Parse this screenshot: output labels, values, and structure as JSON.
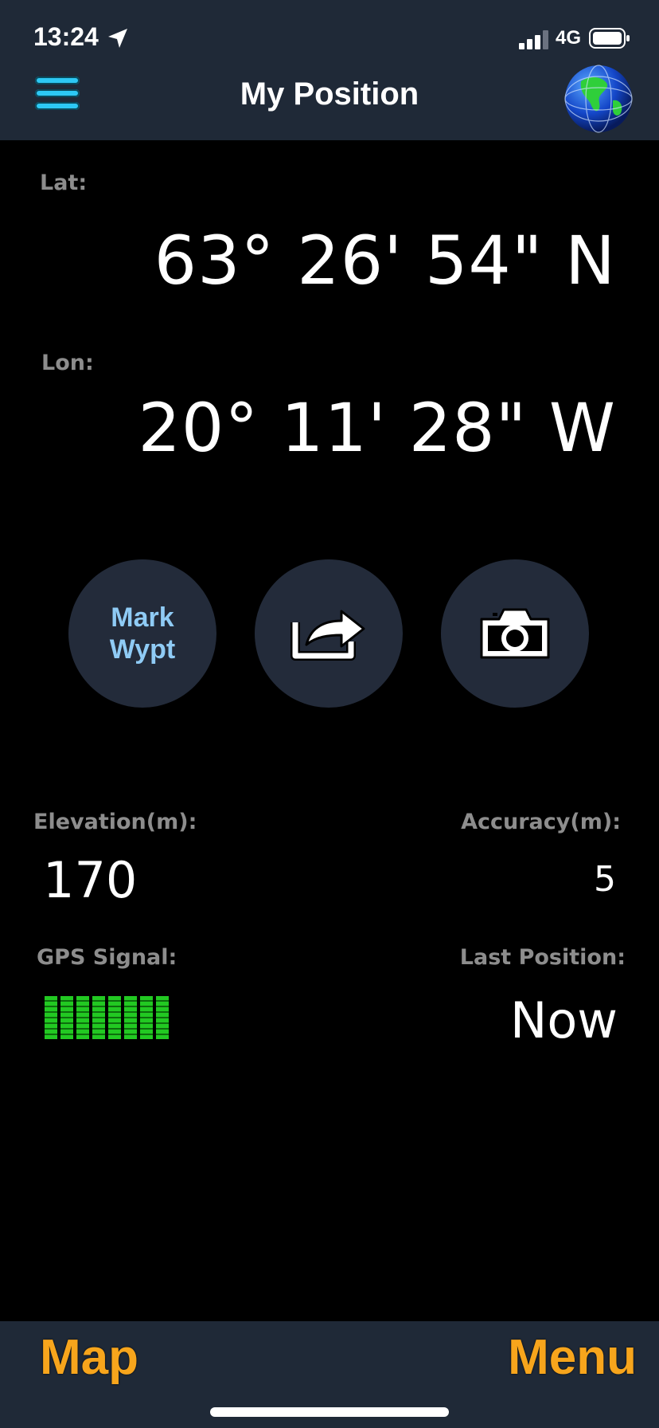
{
  "status_bar": {
    "time": "13:24",
    "network": "4G"
  },
  "header": {
    "title": "My Position",
    "menu_icon": "hamburger-menu-icon",
    "globe_icon": "globe-icon"
  },
  "position": {
    "lat_label": "Lat:",
    "lat_value": "63° 26' 54\" N",
    "lon_label": "Lon:",
    "lon_value": "20° 11' 28\" W"
  },
  "actions": {
    "mark_line1": "Mark",
    "mark_line2": "Wypt",
    "share_icon": "share-icon",
    "camera_icon": "camera-icon"
  },
  "stats": {
    "elevation_label": "Elevation(m):",
    "elevation_value": "170",
    "accuracy_label": "Accuracy(m):",
    "accuracy_value": "5",
    "gps_label": "GPS Signal:",
    "gps_signal_level": 1.0,
    "last_label": "Last Position:",
    "last_value": "Now"
  },
  "bottom_bar": {
    "map_label": "Map",
    "menu_label": "Menu"
  },
  "colors": {
    "accent_orange": "#f7a51c",
    "menu_blue": "#2dc8f4",
    "mark_blue": "#8fcbf5",
    "gps_green": "#22c922",
    "bar_bg": "#1f2937"
  }
}
